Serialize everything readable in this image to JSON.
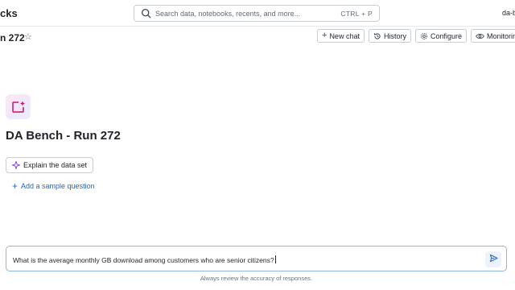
{
  "topbar": {
    "brand_partial": "cks",
    "search": {
      "placeholder": "Search data, notebooks, recents, and more...",
      "shortcut": "CTRL + P",
      "icon": "search-icon"
    },
    "user_partial": "da-b"
  },
  "page": {
    "title_partial": "n 272",
    "star_icon": "☆",
    "actions": {
      "new_chat": {
        "label": "New chat",
        "icon": "+"
      },
      "history": {
        "label": "History",
        "icon": "history-icon"
      },
      "configure": {
        "label": "Configure",
        "icon": "gear-icon"
      },
      "monitoring": {
        "label": "Monitoring",
        "icon": "eye-icon"
      }
    }
  },
  "main": {
    "title": "DA Bench - Run 272",
    "explain_button": "Explain the data set",
    "add_sample": "Add a sample question"
  },
  "chat": {
    "input_value": "What is the average monthly GB download among customers who are senior citizens?",
    "disclaimer": "Always review the accuracy of responses."
  },
  "colors": {
    "accent_blue": "#2168c0",
    "genie_pink": "#d6336c",
    "input_border": "#8fb4e3"
  }
}
